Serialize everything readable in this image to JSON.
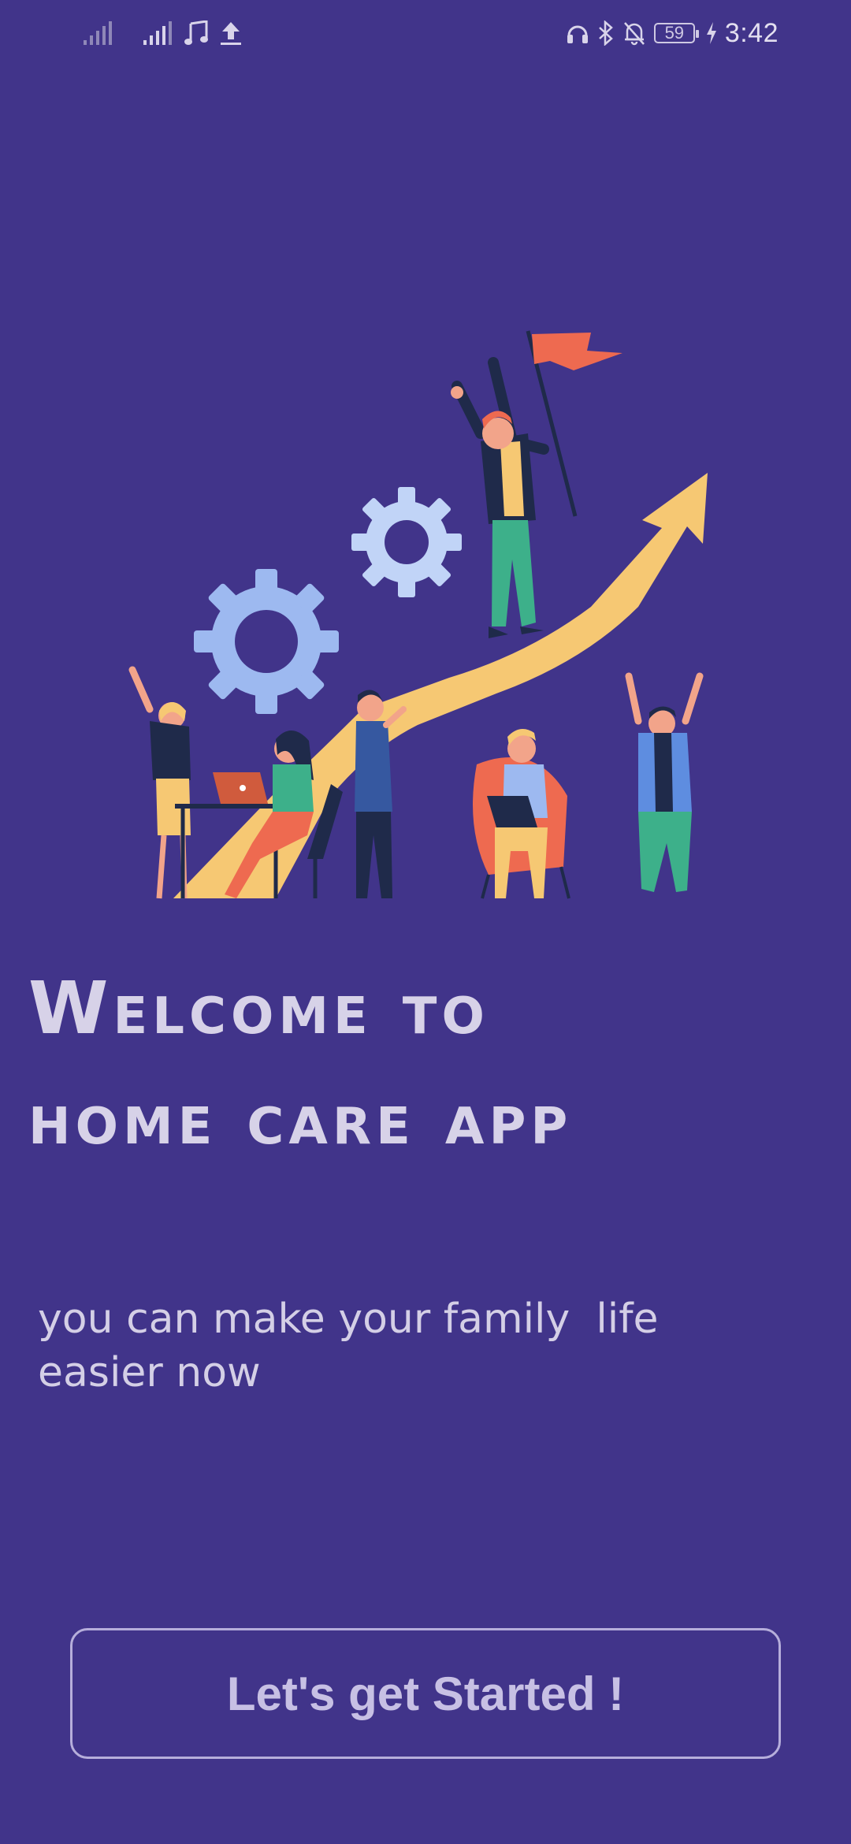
{
  "status_bar": {
    "icons": [
      "signal-weak-icon",
      "signal-icon",
      "music-note-icon",
      "upload-icon",
      "headphones-icon",
      "bluetooth-icon",
      "bell-off-icon",
      "charging-icon"
    ],
    "battery": "59",
    "time": "3:42"
  },
  "hero": {
    "title_line1": "Welcome to",
    "title_line2": "home care app",
    "subtitle_line1": "you can make your family  life",
    "subtitle_line2": "easier now"
  },
  "cta": {
    "label": "Let's get Started !"
  },
  "colors": {
    "background": "#41348a",
    "text": "#d7d2e8",
    "button_border": "#b6aedb",
    "arrow": "#f6c873",
    "gear": "#9db9f0",
    "flag": "#ee6a50"
  }
}
